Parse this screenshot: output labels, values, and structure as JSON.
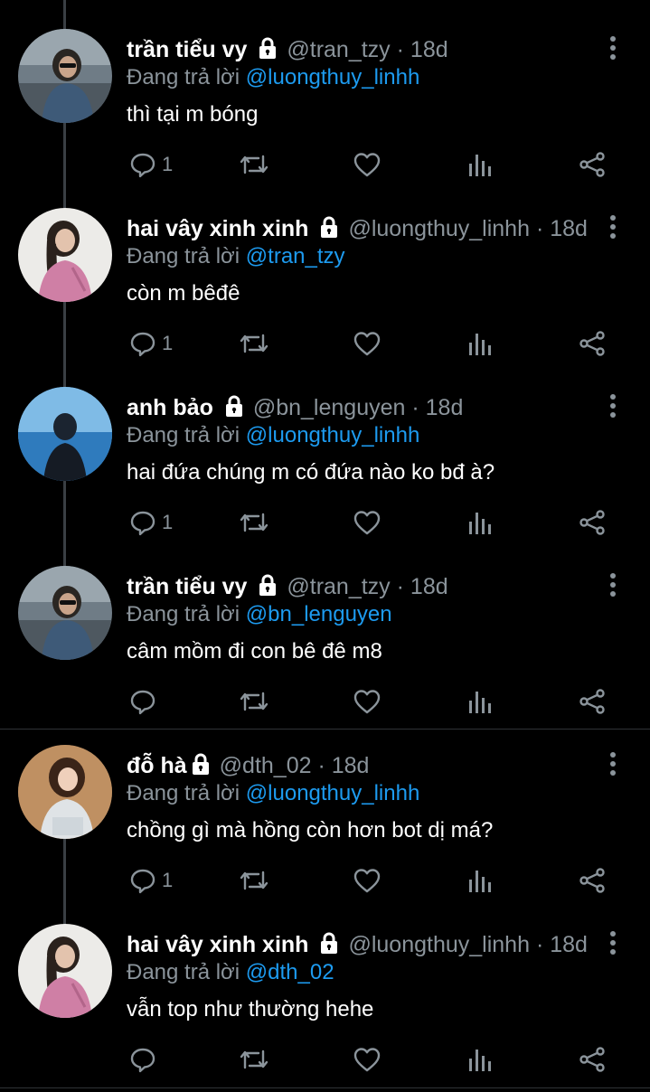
{
  "reply_prefix": "Đang trả lời",
  "tweets": [
    {
      "name": "trần tiểu vy",
      "handle": "@tran_tzy",
      "dot": "·",
      "time": "18d",
      "replying_to": "@luongthuy_linhh",
      "text": "thì tại m bóng",
      "replies": "1"
    },
    {
      "name": "hai vây xinh xinh",
      "handle": "@luongthuy_linhh",
      "dot": "·",
      "time": "18d",
      "replying_to": "@tran_tzy",
      "text": "còn m bêđê",
      "replies": "1"
    },
    {
      "name": "anh bảo",
      "handle": "@bn_lenguyen",
      "dot": "·",
      "time": "18d",
      "replying_to": "@luongthuy_linhh",
      "text": "hai đứa chúng m có đứa nào ko bđ à?",
      "replies": "1"
    },
    {
      "name": "trần tiểu vy",
      "handle": "@tran_tzy",
      "dot": "·",
      "time": "18d",
      "replying_to": "@bn_lenguyen",
      "text": "câm mồm đi con bê đê m8",
      "replies": ""
    },
    {
      "name": "đỗ hà",
      "handle": "@dth_02",
      "dot": "·",
      "time": "18d",
      "replying_to": "@luongthuy_linhh",
      "text": "chồng gì mà hồng còn hơn bot dị má?",
      "replies": "1"
    },
    {
      "name": "hai vây xinh xinh",
      "handle": "@luongthuy_linhh",
      "dot": "·",
      "time": "18d",
      "replying_to": "@dth_02",
      "text": "vẫn top như thường hehe",
      "replies": ""
    }
  ],
  "icons": {
    "avatar": "avatar-photo",
    "lock": "lock-icon",
    "more": "more-vertical-icon",
    "reply": "reply-icon",
    "retweet": "retweet-icon",
    "like": "like-icon",
    "analytics": "analytics-icon",
    "share": "share-icon"
  },
  "colors": {
    "background": "#000000",
    "text": "#ffffff",
    "muted": "#8b949b",
    "link": "#1d9bf0",
    "thread_line": "#3a3f44",
    "divider": "#2f3336"
  }
}
